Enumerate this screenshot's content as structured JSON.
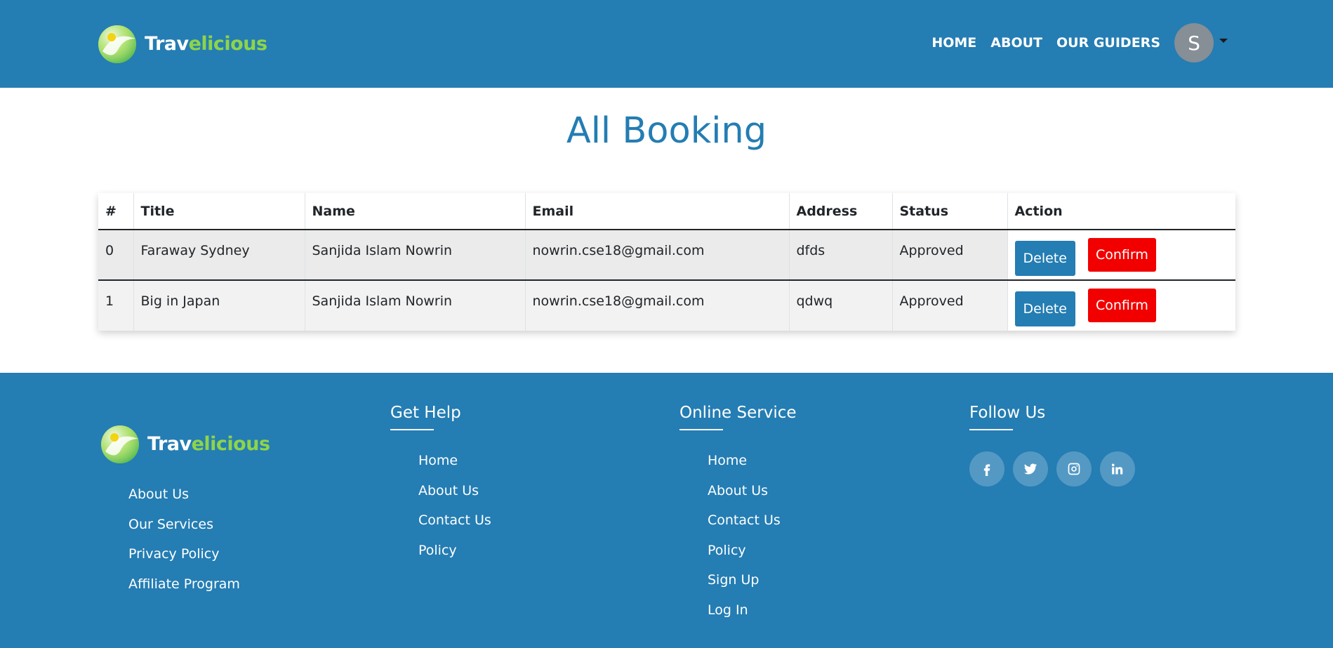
{
  "brand": {
    "name_part1": "Trav",
    "name_part2": "elicious"
  },
  "nav": {
    "links": [
      "HOME",
      "ABOUT",
      "OUR GUIDERS"
    ],
    "avatar_initial": "S"
  },
  "main": {
    "title": "All Booking",
    "table": {
      "columns": [
        "#",
        "Title",
        "Name",
        "Email",
        "Address",
        "Status",
        "Action"
      ],
      "rows": [
        {
          "index": "0",
          "title": "Faraway Sydney",
          "name": "Sanjida Islam Nowrin",
          "email": "nowrin.cse18@gmail.com",
          "address": "dfds",
          "status": "Approved"
        },
        {
          "index": "1",
          "title": "Big in Japan",
          "name": "Sanjida Islam Nowrin",
          "email": "nowrin.cse18@gmail.com",
          "address": "qdwq",
          "status": "Approved"
        }
      ],
      "delete_label": "Delete",
      "confirm_label": "Confirm"
    }
  },
  "footer": {
    "col1_links": [
      "About Us",
      "Our Services",
      "Privacy Policy",
      "Affiliate Program"
    ],
    "col2": {
      "heading": "Get Help",
      "links": [
        "Home",
        "About Us",
        "Contact Us",
        "Policy"
      ]
    },
    "col3": {
      "heading": "Online Service",
      "links": [
        "Home",
        "About Us",
        "Contact Us",
        "Policy",
        "Sign Up",
        "Log In"
      ]
    },
    "col4": {
      "heading": "Follow Us",
      "socials": [
        "facebook-icon",
        "twitter-icon",
        "instagram-icon",
        "linkedin-icon"
      ]
    }
  },
  "colors": {
    "primary": "#247db3",
    "danger": "#f20000",
    "brand_green": "#8ed44a",
    "avatar_gray": "#868e96"
  }
}
